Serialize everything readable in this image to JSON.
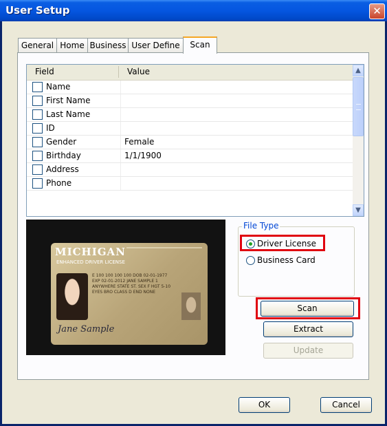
{
  "window": {
    "title": "User Setup",
    "close_glyph": "✕"
  },
  "tabs": [
    {
      "label": "General"
    },
    {
      "label": "Home"
    },
    {
      "label": "Business"
    },
    {
      "label": "User Define"
    },
    {
      "label": "Scan",
      "active": true
    }
  ],
  "grid": {
    "headers": {
      "field": "Field",
      "value": "Value"
    },
    "rows": [
      {
        "field": "Name",
        "value": ""
      },
      {
        "field": "First Name",
        "value": ""
      },
      {
        "field": "Last Name",
        "value": ""
      },
      {
        "field": "ID",
        "value": ""
      },
      {
        "field": "Gender",
        "value": "Female"
      },
      {
        "field": "Birthday",
        "value": "1/1/1900"
      },
      {
        "field": "Address",
        "value": ""
      },
      {
        "field": "Phone",
        "value": ""
      }
    ],
    "scroll_up_glyph": "▲",
    "scroll_down_glyph": "▼"
  },
  "scan_image": {
    "card_title": "MICHIGAN",
    "card_subtitle": "ENHANCED DRIVER LICENSE",
    "card_text": "E 100 100 100 100 DOB 02-01-1977 EXP 02-01-2012 JANE SAMPLE 1 ANYWHERE STATE ST. SEX F HGT 5-10 EYES BRO CLASS D END NONE",
    "signature": "Jane Sample"
  },
  "file_type": {
    "legend": "File Type",
    "options": [
      {
        "label": "Driver License",
        "selected": true
      },
      {
        "label": "Business Card",
        "selected": false
      }
    ]
  },
  "buttons": {
    "scan": "Scan",
    "extract": "Extract",
    "update": "Update",
    "ok": "OK",
    "cancel": "Cancel"
  },
  "colors": {
    "highlight": "#e0000f",
    "title_bar": "#0556e0",
    "tab_accent": "#f5a623"
  }
}
